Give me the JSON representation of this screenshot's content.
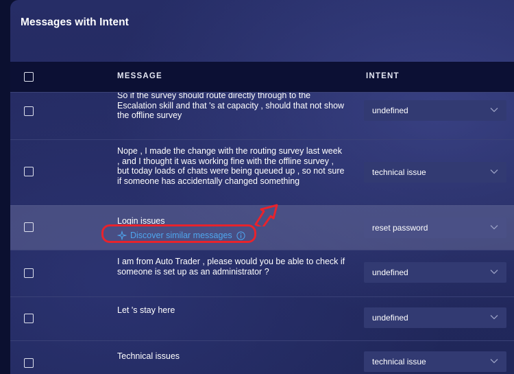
{
  "panel": {
    "title": "Messages with Intent"
  },
  "table": {
    "headers": {
      "message": "MESSAGE",
      "intent": "INTENT"
    },
    "rows": [
      {
        "lines": [
          "So if the survey should route directly through to the",
          "Escalation skill and that 's at capacity , should that not show",
          "the offline survey"
        ],
        "intent": "undefined"
      },
      {
        "lines": [
          "Nope , I made the change with the routing survey last week",
          ", and I thought it was working fine with the offline survey ,",
          "but today loads of chats were being queued up , so not sure",
          "if someone has accidentally changed something"
        ],
        "intent": "technical issue"
      },
      {
        "lines": [
          "Login issues"
        ],
        "intent": "reset password",
        "discover_link": "Discover similar messages"
      },
      {
        "lines": [
          "I am from Auto Trader , please would you be able to check if",
          "someone is set up as an administrator ?"
        ],
        "intent": "undefined"
      },
      {
        "lines": [
          "Let 's stay here"
        ],
        "intent": "undefined"
      },
      {
        "lines": [
          "Technical issues"
        ],
        "intent": "technical issue"
      }
    ]
  },
  "icons": {
    "chevron": "chevron-down-icon",
    "sparkle": "sparkle-icon",
    "info": "info-icon"
  },
  "colors": {
    "link": "#4fa6ee",
    "annotation": "#e8232c",
    "header_bg": "#0c1034"
  }
}
